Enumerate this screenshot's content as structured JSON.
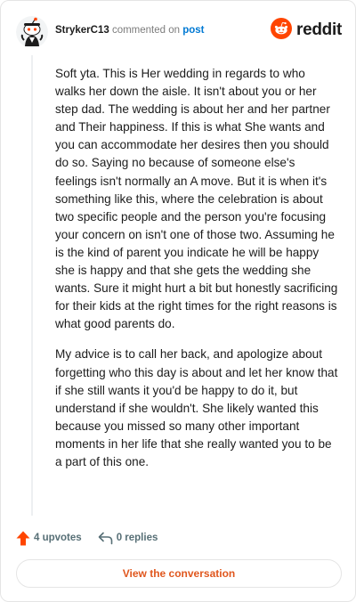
{
  "colors": {
    "brand_orange": "#FF4500",
    "link_blue": "#0079D3",
    "button_text": "#E0571E",
    "meta_gray": "#576F76"
  },
  "header": {
    "username": "StrykerC13",
    "action_text": "commented on",
    "post_link_text": "post",
    "logo_word": "reddit",
    "avatar_icon": "snoo-avatar-icon",
    "logo_icon": "reddit-logo-icon"
  },
  "comment": {
    "paragraphs": [
      "Soft yta. This is Her wedding in regards to who walks her down the aisle. It isn't about you or her step dad. The wedding is about her and her partner and Their happiness. If this is what She wants and you can accommodate her desires then you should do so. Saying no because of someone else's feelings isn't normally an A move. But it is when it's something like this, where the celebration is about two specific people and the person you're focusing your concern on isn't one of those two. Assuming he is the kind of parent you indicate he will be happy she is happy and that she gets the wedding she wants. Sure it might hurt a bit but honestly sacrificing for their kids at the right times for the right reasons is what good parents do.",
      "My advice is to call her back, and apologize about forgetting who this day is about and let her know that if she still wants it you'd be happy to do it, but understand if she wouldn't. She likely wanted this because you missed so many other important moments in her life that she really wanted you to be a part of this one."
    ]
  },
  "footer": {
    "upvotes_label": "4 upvotes",
    "replies_label": "0 replies",
    "upvote_icon": "upvote-arrow-icon",
    "reply_icon": "reply-arrow-icon"
  },
  "cta": {
    "label": "View the conversation"
  }
}
